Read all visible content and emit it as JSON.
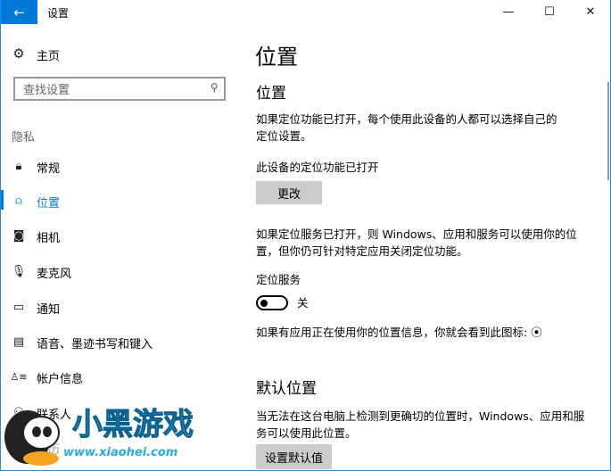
{
  "window": {
    "title": "设置",
    "back_icon": "←",
    "minimize": "—",
    "maximize": "☐",
    "close": "✕"
  },
  "sidebar": {
    "home": "主页",
    "search_placeholder": "查找设置",
    "section": "隐私",
    "items": [
      {
        "label": "常规",
        "icon": "lock-icon"
      },
      {
        "label": "位置",
        "icon": "location-icon",
        "selected": true
      },
      {
        "label": "相机",
        "icon": "camera-icon"
      },
      {
        "label": "麦克风",
        "icon": "microphone-icon"
      },
      {
        "label": "通知",
        "icon": "notification-icon"
      },
      {
        "label": "语音、墨迹书写和键入",
        "icon": "speech-icon"
      },
      {
        "label": "帐户信息",
        "icon": "account-info-icon"
      },
      {
        "label": "联系人",
        "icon": "contacts-icon"
      },
      {
        "label": "日历",
        "icon": "calendar-icon"
      }
    ]
  },
  "main": {
    "page_title": "位置",
    "section1": {
      "title": "位置",
      "desc": "如果定位功能已打开，每个使用此设备的人都可以选择自己的定位设置。",
      "status": "此设备的定位功能已打开",
      "change_button": "更改",
      "desc2": "如果定位服务已打开，则 Windows、应用和服务可以使用你的位置，但你仍可针对特定应用关闭定位功能。",
      "toggle_label": "定位服务",
      "toggle_state": "关",
      "icon_hint": "如果有应用正在使用你的位置信息，你就会看到此图标:"
    },
    "section2": {
      "title": "默认位置",
      "desc": "当无法在这台电脑上检测到更确切的位置时，Windows、应用和服务可以使用此位置。",
      "set_default_button": "设置默认值"
    }
  },
  "watermark": {
    "brand": "小黑游戏",
    "url": "www.xiaohei.com"
  },
  "colors": {
    "accent": "#0078d7"
  }
}
